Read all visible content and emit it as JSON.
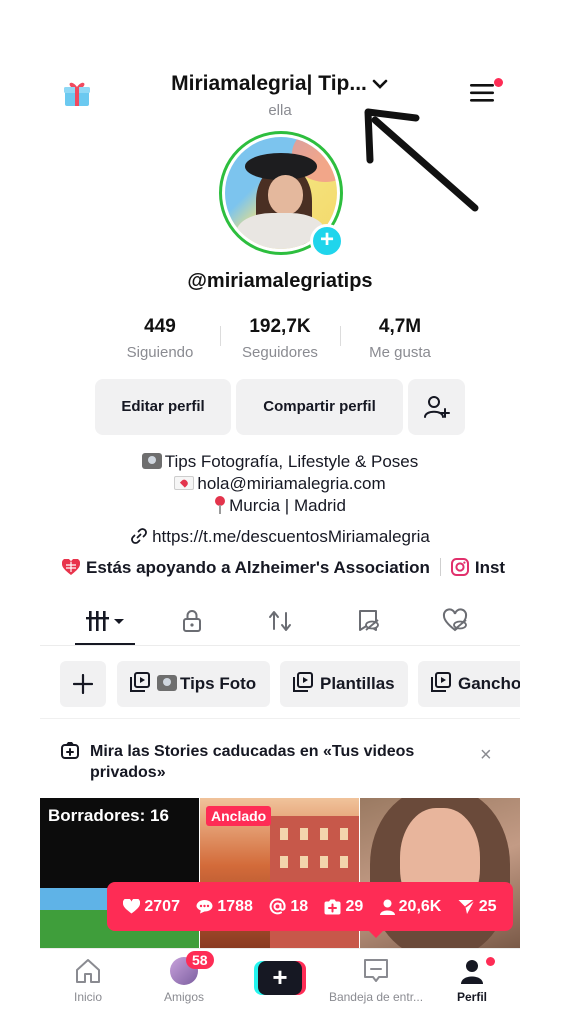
{
  "header": {
    "title": "Miriamalegria| Tip...",
    "pronoun": "ella"
  },
  "profile": {
    "handle": "@miriamalegriatips",
    "stats": [
      {
        "value": "449",
        "label": "Siguiendo"
      },
      {
        "value": "192,7K",
        "label": "Seguidores"
      },
      {
        "value": "4,7M",
        "label": "Me gusta"
      }
    ],
    "buttons": {
      "edit": "Editar perfil",
      "share": "Compartir perfil"
    },
    "bio": [
      "Tips Fotografía, Lifestyle & Poses",
      "hola@miriamalegria.com",
      "Murcia | Madrid"
    ],
    "link": "https://t.me/descuentosMiriamalegria",
    "support": "Estás apoyando a Alzheimer's Association",
    "instagram": "Inst"
  },
  "playlists": [
    "Tips Foto",
    "Plantillas",
    "Gancho"
  ],
  "stories_notice": "Mira las Stories caducadas en «Tus videos privados»",
  "close_symbol": "×",
  "grid": {
    "drafts": "Borradores: 16",
    "pinned": "Anclado"
  },
  "video_stats": {
    "likes": "2707",
    "comments": "1788",
    "mentions": "18",
    "saves": "29",
    "views": "20,6K",
    "shares": "25"
  },
  "nav": {
    "home": "Inicio",
    "friends": "Amigos",
    "friends_badge": "58",
    "create": "+",
    "inbox": "Bandeja de entr...",
    "profile": "Perfil"
  },
  "colors": {
    "accent": "#fe2c55",
    "cyan": "#20d5ec",
    "text": "#161823",
    "muted": "#8a8b91"
  }
}
